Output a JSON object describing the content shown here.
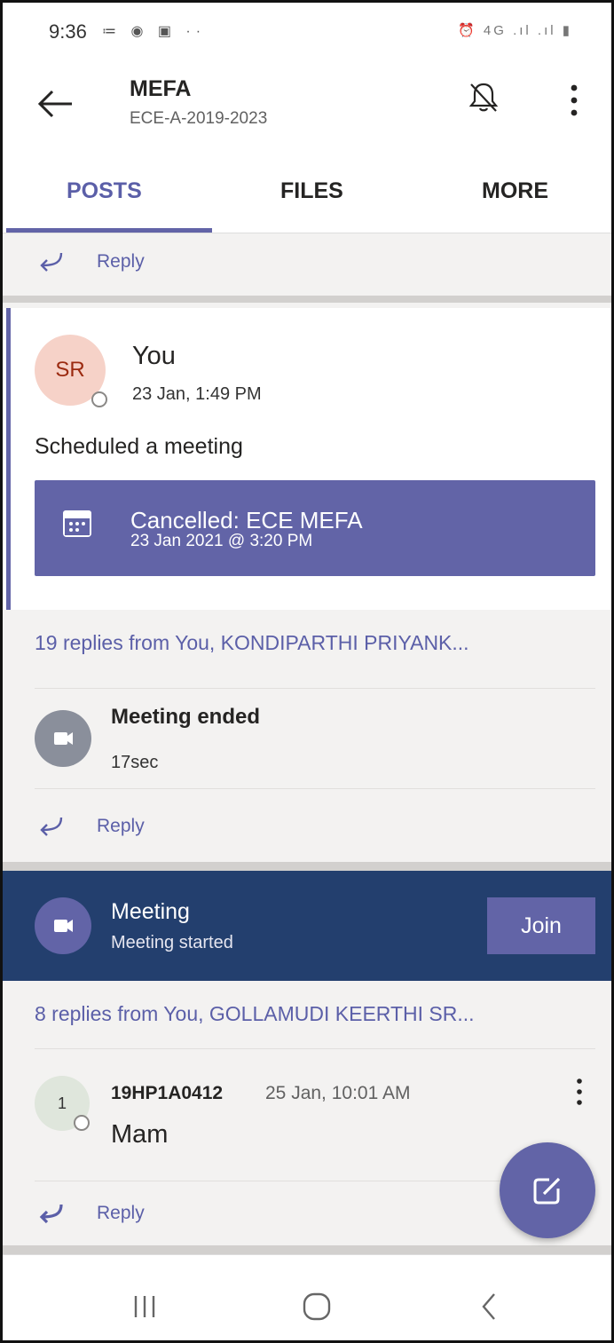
{
  "status_bar": {
    "time": "9:36",
    "left_icons": "≔ ◉ ▣ ··",
    "right_icons": "⏰ 4G .ıl .ıl ▮"
  },
  "header": {
    "title": "MEFA",
    "subtitle": "ECE-A-2019-2023",
    "icons": [
      "back-arrow-icon",
      "bell-off-icon",
      "more-vertical-icon"
    ]
  },
  "tabs": [
    {
      "label": "POSTS",
      "active": true
    },
    {
      "label": "FILES",
      "active": false
    },
    {
      "label": "MORE",
      "active": false
    }
  ],
  "reply_label": "Reply",
  "post": {
    "avatar_initials": "SR",
    "author": "You",
    "timestamp": "23 Jan, 1:49 PM",
    "body": "Scheduled a meeting",
    "meeting_card": {
      "title": "Cancelled: ECE MEFA",
      "date": "23 Jan 2021 @ 3:20 PM"
    }
  },
  "thread1": {
    "replies_summary": "19 replies from You, KONDIPARTHI PRIYANK...",
    "event_title": "Meeting ended",
    "event_duration": "17sec"
  },
  "banner": {
    "title": "Meeting",
    "subtitle": "Meeting started",
    "join_label": "Join"
  },
  "thread2": {
    "replies_summary": "8 replies from You, GOLLAMUDI KEERTHI SR...",
    "message": {
      "avatar_initial": "1",
      "sender": "19HP1A0412",
      "time": "25 Jan, 10:01 AM",
      "text": "Mam"
    }
  },
  "colors": {
    "accent": "#6264a7",
    "banner": "#233f6e",
    "background": "#f3f2f1"
  }
}
